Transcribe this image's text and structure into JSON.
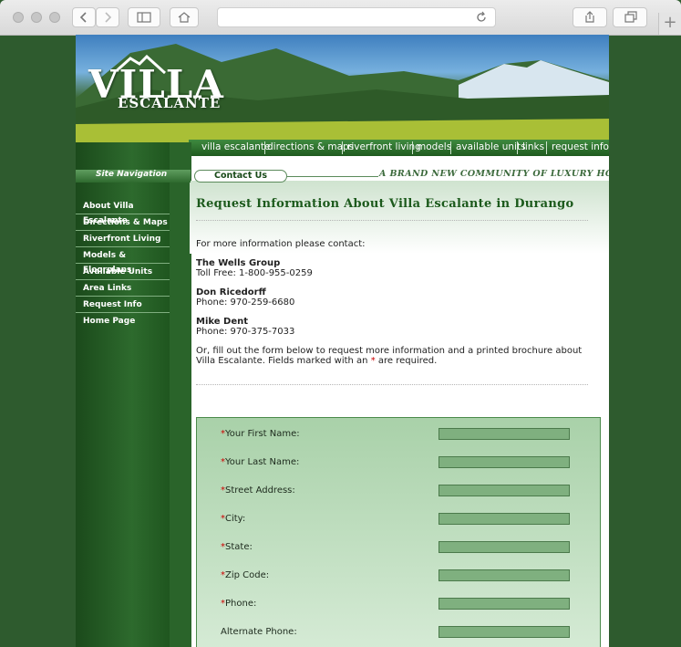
{
  "browser": {
    "url": ""
  },
  "banner": {
    "logo_main": "VILLA",
    "logo_sub": "ESCALANTE"
  },
  "top_nav": [
    "villa escalante",
    "directions & maps",
    "riverfront living",
    "models",
    "available units",
    "links",
    "request info"
  ],
  "sidebar": {
    "heading": "Site Navigation",
    "items": [
      "About Villa Escalante",
      "Directions & Maps",
      "Riverfront Living",
      "Models & Floorplans",
      "Available Units",
      "Area Links",
      "Request Info",
      "Home Page"
    ]
  },
  "contact_pill": "Contact Us",
  "tagline": "A BRAND NEW COMMUNITY OF LUXURY HOMES",
  "main": {
    "title": "Request Information About Villa Escalante in Durango",
    "intro": "For more information please contact:",
    "contacts": [
      {
        "name": "The Wells Group",
        "line": "Toll Free: 1-800-955-0259"
      },
      {
        "name": "Don Ricedorff",
        "line": "Phone: 970-259-6680"
      },
      {
        "name": "Mike Dent",
        "line": "Phone: 970-375-7033"
      }
    ],
    "note_before": "Or, fill out the form below to request more information and a printed brochure about Villa Escalante. Fields marked with an",
    "note_star": "*",
    "note_after": "are required."
  },
  "form": {
    "fields": [
      {
        "label": "Your First Name:",
        "required": true
      },
      {
        "label": "Your Last Name:",
        "required": true
      },
      {
        "label": "Street Address:",
        "required": true
      },
      {
        "label": "City:",
        "required": true
      },
      {
        "label": "State:",
        "required": true
      },
      {
        "label": "Zip Code:",
        "required": true
      },
      {
        "label": "Phone:",
        "required": true
      },
      {
        "label": "Alternate Phone:",
        "required": false
      }
    ]
  }
}
